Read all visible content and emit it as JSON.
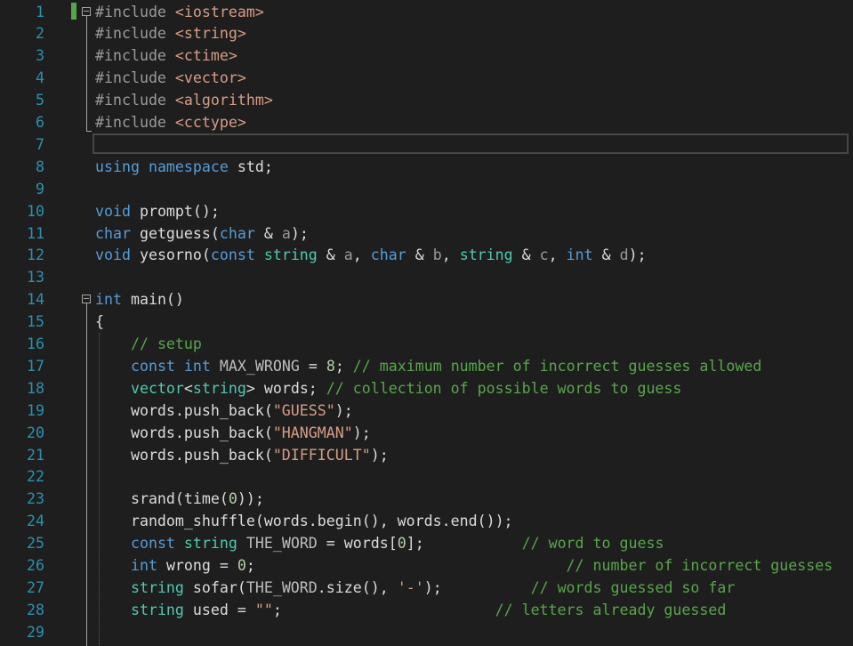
{
  "line_numbers": [
    "1",
    "2",
    "3",
    "4",
    "5",
    "6",
    "7",
    "8",
    "9",
    "10",
    "11",
    "12",
    "13",
    "14",
    "15",
    "16",
    "17",
    "18",
    "19",
    "20",
    "21",
    "22",
    "23",
    "24",
    "25",
    "26",
    "27",
    "28",
    "29"
  ],
  "lines": [
    [
      {
        "c": "pp",
        "t": "#include "
      },
      {
        "c": "str",
        "t": "<iostream>"
      }
    ],
    [
      {
        "c": "pp",
        "t": "#include "
      },
      {
        "c": "str",
        "t": "<string>"
      }
    ],
    [
      {
        "c": "pp",
        "t": "#include "
      },
      {
        "c": "str",
        "t": "<ctime>"
      }
    ],
    [
      {
        "c": "pp",
        "t": "#include "
      },
      {
        "c": "str",
        "t": "<vector>"
      }
    ],
    [
      {
        "c": "pp",
        "t": "#include "
      },
      {
        "c": "str",
        "t": "<algorithm>"
      }
    ],
    [
      {
        "c": "pp",
        "t": "#include "
      },
      {
        "c": "str",
        "t": "<cctype>"
      }
    ],
    [],
    [
      {
        "c": "kw",
        "t": "using"
      },
      {
        "c": "",
        "t": " "
      },
      {
        "c": "kw",
        "t": "namespace"
      },
      {
        "c": "",
        "t": " std;"
      }
    ],
    [],
    [
      {
        "c": "kw",
        "t": "void"
      },
      {
        "c": "",
        "t": " prompt();"
      }
    ],
    [
      {
        "c": "kw",
        "t": "char"
      },
      {
        "c": "",
        "t": " getguess("
      },
      {
        "c": "kw",
        "t": "char"
      },
      {
        "c": "",
        "t": " & "
      },
      {
        "c": "par",
        "t": "a"
      },
      {
        "c": "",
        "t": ");"
      }
    ],
    [
      {
        "c": "kw",
        "t": "void"
      },
      {
        "c": "",
        "t": " yesorno("
      },
      {
        "c": "kw",
        "t": "const"
      },
      {
        "c": "",
        "t": " "
      },
      {
        "c": "ty",
        "t": "string"
      },
      {
        "c": "",
        "t": " & "
      },
      {
        "c": "par",
        "t": "a"
      },
      {
        "c": "",
        "t": ", "
      },
      {
        "c": "kw",
        "t": "char"
      },
      {
        "c": "",
        "t": " & "
      },
      {
        "c": "par",
        "t": "b"
      },
      {
        "c": "",
        "t": ", "
      },
      {
        "c": "ty",
        "t": "string"
      },
      {
        "c": "",
        "t": " & "
      },
      {
        "c": "par",
        "t": "c"
      },
      {
        "c": "",
        "t": ", "
      },
      {
        "c": "kw",
        "t": "int"
      },
      {
        "c": "",
        "t": " & "
      },
      {
        "c": "par",
        "t": "d"
      },
      {
        "c": "",
        "t": ");"
      }
    ],
    [],
    [
      {
        "c": "kw",
        "t": "int"
      },
      {
        "c": "",
        "t": " main()"
      }
    ],
    [
      {
        "c": "",
        "t": "{"
      }
    ],
    [
      {
        "c": "",
        "t": "    "
      },
      {
        "c": "cm",
        "t": "// setup"
      }
    ],
    [
      {
        "c": "",
        "t": "    "
      },
      {
        "c": "kw",
        "t": "const"
      },
      {
        "c": "",
        "t": " "
      },
      {
        "c": "kw",
        "t": "int"
      },
      {
        "c": "",
        "t": " "
      },
      {
        "c": "cst",
        "t": "MAX_WRONG"
      },
      {
        "c": "",
        "t": " = "
      },
      {
        "c": "num",
        "t": "8"
      },
      {
        "c": "",
        "t": "; "
      },
      {
        "c": "cm",
        "t": "// maximum number of incorrect guesses allowed"
      }
    ],
    [
      {
        "c": "",
        "t": "    "
      },
      {
        "c": "ty",
        "t": "vector"
      },
      {
        "c": "",
        "t": "<"
      },
      {
        "c": "ty",
        "t": "string"
      },
      {
        "c": "",
        "t": "> words; "
      },
      {
        "c": "cm",
        "t": "// collection of possible words to guess"
      }
    ],
    [
      {
        "c": "",
        "t": "    words.push_back("
      },
      {
        "c": "str",
        "t": "\"GUESS\""
      },
      {
        "c": "",
        "t": ");"
      }
    ],
    [
      {
        "c": "",
        "t": "    words.push_back("
      },
      {
        "c": "str",
        "t": "\"HANGMAN\""
      },
      {
        "c": "",
        "t": ");"
      }
    ],
    [
      {
        "c": "",
        "t": "    words.push_back("
      },
      {
        "c": "str",
        "t": "\"DIFFICULT\""
      },
      {
        "c": "",
        "t": ");"
      }
    ],
    [],
    [
      {
        "c": "",
        "t": "    srand(time("
      },
      {
        "c": "num",
        "t": "0"
      },
      {
        "c": "",
        "t": "));"
      }
    ],
    [
      {
        "c": "",
        "t": "    random_shuffle(words.begin(), words.end());"
      }
    ],
    [
      {
        "c": "",
        "t": "    "
      },
      {
        "c": "kw",
        "t": "const"
      },
      {
        "c": "",
        "t": " "
      },
      {
        "c": "ty",
        "t": "string"
      },
      {
        "c": "",
        "t": " "
      },
      {
        "c": "cst",
        "t": "THE_WORD"
      },
      {
        "c": "",
        "t": " = words["
      },
      {
        "c": "num",
        "t": "0"
      },
      {
        "c": "",
        "t": "];           "
      },
      {
        "c": "cm",
        "t": "// word to guess"
      }
    ],
    [
      {
        "c": "",
        "t": "    "
      },
      {
        "c": "kw",
        "t": "int"
      },
      {
        "c": "",
        "t": " wrong = "
      },
      {
        "c": "num",
        "t": "0"
      },
      {
        "c": "",
        "t": ";                                   "
      },
      {
        "c": "cm",
        "t": "// number of incorrect guesses"
      }
    ],
    [
      {
        "c": "",
        "t": "    "
      },
      {
        "c": "ty",
        "t": "string"
      },
      {
        "c": "",
        "t": " sofar("
      },
      {
        "c": "cst",
        "t": "THE_WORD"
      },
      {
        "c": "",
        "t": ".size(), "
      },
      {
        "c": "str",
        "t": "'-'"
      },
      {
        "c": "",
        "t": ");          "
      },
      {
        "c": "cm",
        "t": "// words guessed so far"
      }
    ],
    [
      {
        "c": "",
        "t": "    "
      },
      {
        "c": "ty",
        "t": "string"
      },
      {
        "c": "",
        "t": " used = "
      },
      {
        "c": "str",
        "t": "\"\""
      },
      {
        "c": "",
        "t": ";                        "
      },
      {
        "c": "cm",
        "t": "// letters already guessed"
      }
    ],
    []
  ]
}
